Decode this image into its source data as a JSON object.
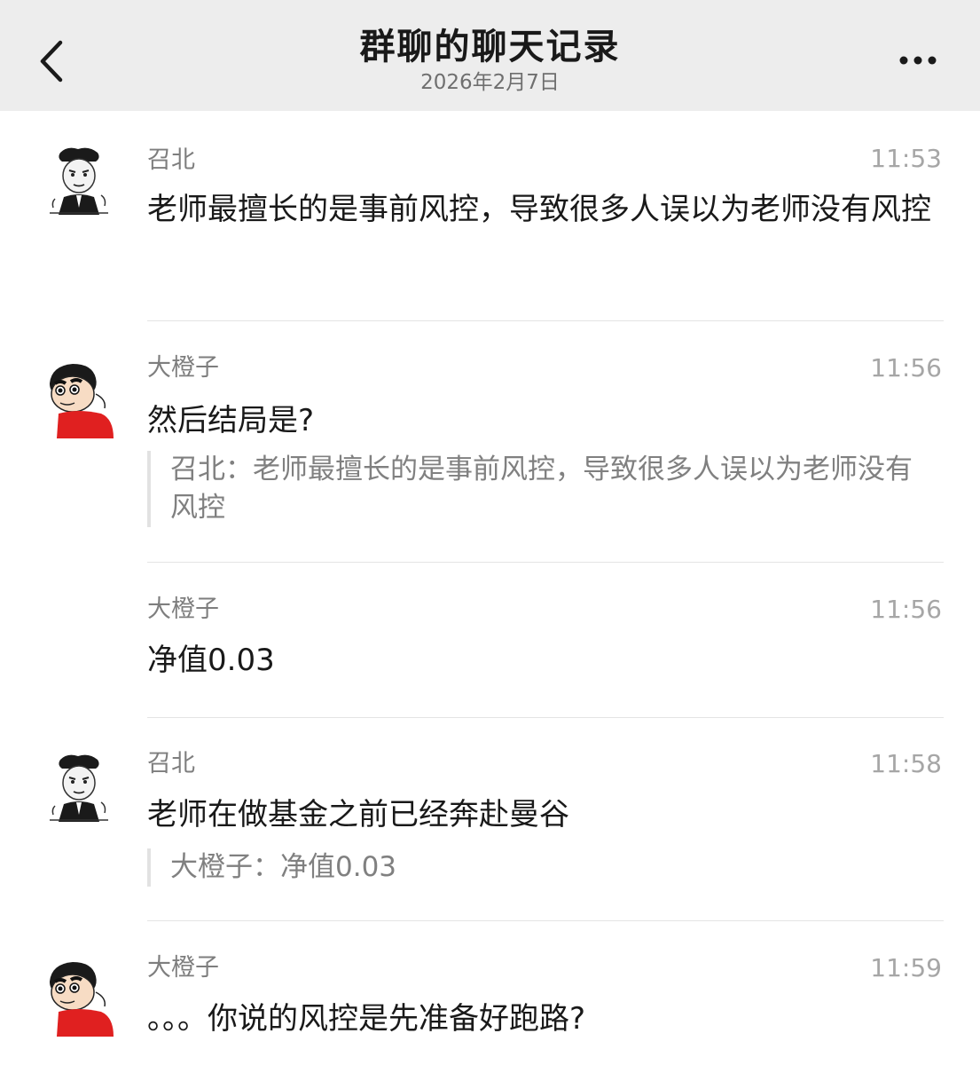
{
  "header": {
    "title": "群聊的聊天记录",
    "date": "2026年2月7日",
    "back_icon": "chevron-left-icon",
    "more_icon": "more-horizontal-icon",
    "background": "#ededed"
  },
  "messages": [
    {
      "sender": "召北",
      "time": "11:53",
      "text": "老师最擅长的是事前风控，导致很多人误以为老师没有风控",
      "avatar": "meme-face-avatar"
    },
    {
      "sender": "大橙子",
      "time": "11:56",
      "text": "然后结局是?",
      "quote": "召北：老师最擅长的是事前风控，导致很多人误以为老师没有风控",
      "avatar": "cartoon-boy-avatar"
    },
    {
      "sender": "大橙子",
      "time": "11:56",
      "text": "净值0.03"
    },
    {
      "sender": "召北",
      "time": "11:58",
      "text": "老师在做基金之前已经奔赴曼谷",
      "quote": "大橙子：净值0.03",
      "avatar": "meme-face-avatar"
    },
    {
      "sender": "大橙子",
      "time": "11:59",
      "text": "。。。你说的风控是先准备好跑路?",
      "avatar": "cartoon-boy-avatar"
    }
  ]
}
